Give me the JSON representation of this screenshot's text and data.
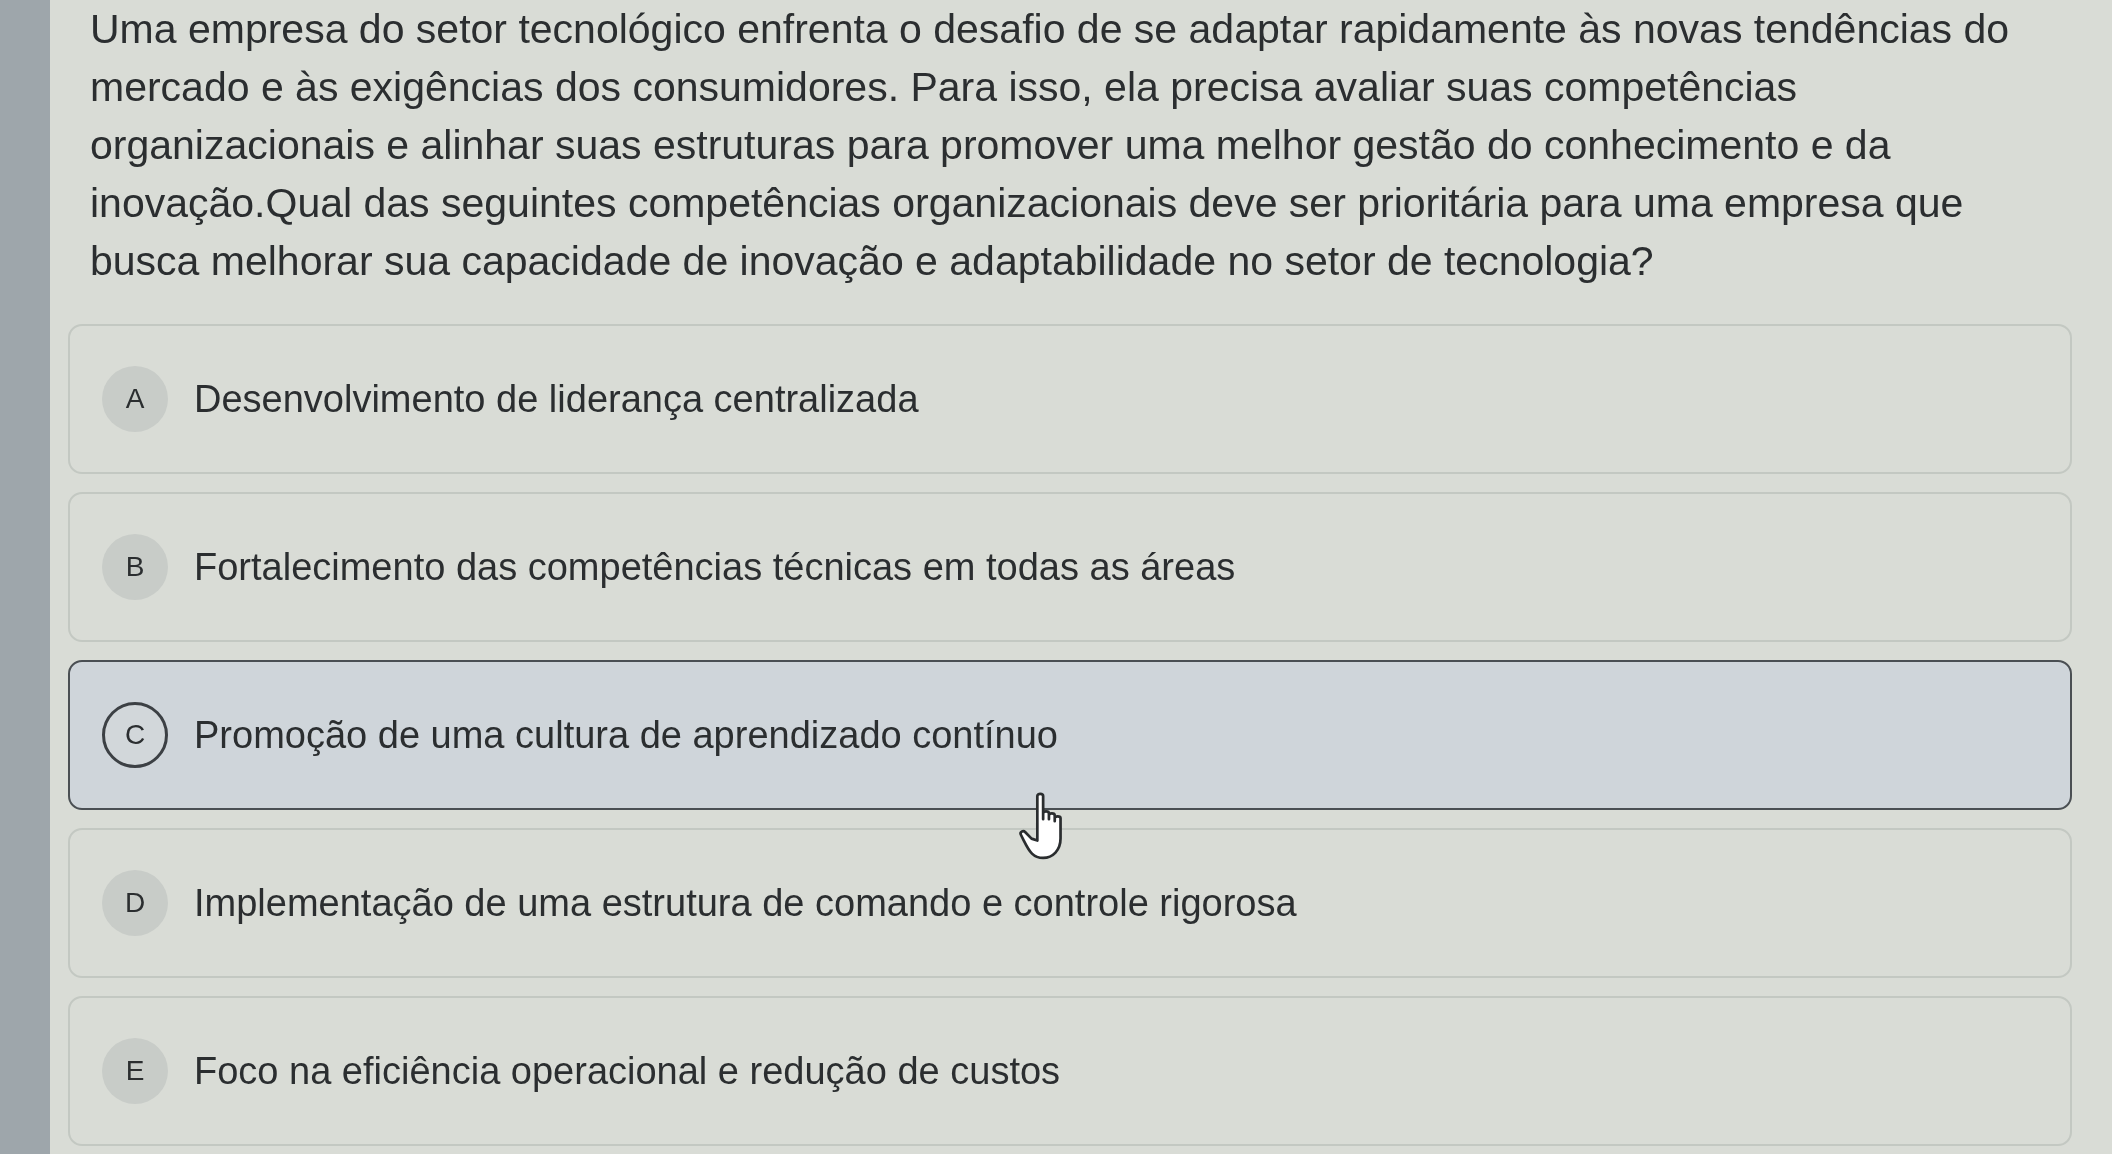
{
  "question": "Uma empresa do setor tecnológico enfrenta o desafio de se adaptar rapidamente às novas tendências do mercado e às exigências dos consumidores. Para isso, ela precisa avaliar suas competências organizacionais e alinhar suas estruturas para promover uma melhor gestão do conhecimento e da inovação.Qual das seguintes competências organizacionais deve ser prioritária para uma empresa que busca melhorar sua capacidade de inovação e adaptabilidade no setor de tecnologia?",
  "options": [
    {
      "letter": "A",
      "text": "Desenvolvimento de liderança centralizada",
      "selected": false
    },
    {
      "letter": "B",
      "text": "Fortalecimento das competências técnicas em todas as áreas",
      "selected": false
    },
    {
      "letter": "C",
      "text": "Promoção de uma cultura de aprendizado contínuo",
      "selected": true
    },
    {
      "letter": "D",
      "text": "Implementação de uma estrutura de comando e controle rigorosa",
      "selected": false
    },
    {
      "letter": "E",
      "text": "Foco na eficiência operacional e redução de custos",
      "selected": false
    }
  ]
}
